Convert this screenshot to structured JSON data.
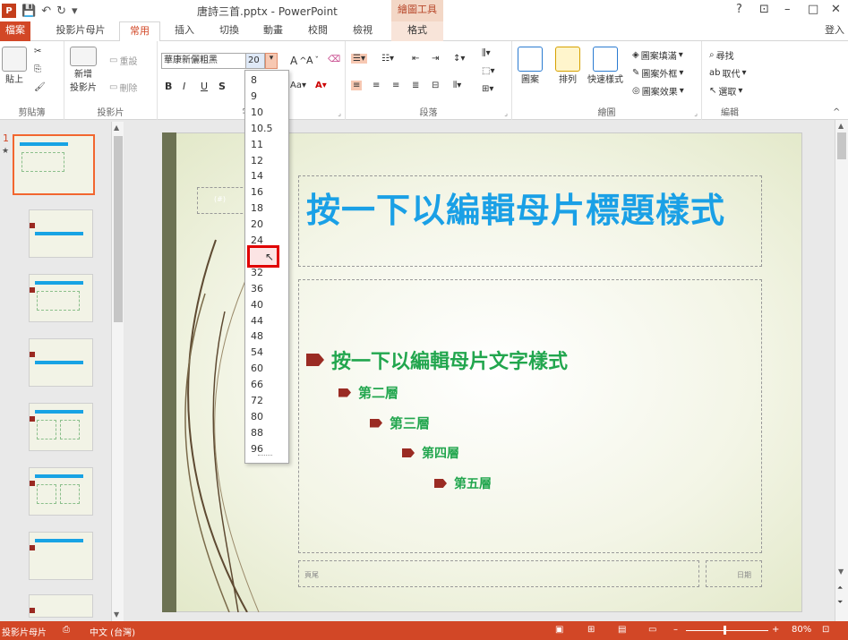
{
  "app": {
    "document_title": "唐詩三首.pptx - PowerPoint",
    "context_tab_group": "繪圖工具",
    "window_controls": [
      "?",
      "⊡",
      "–",
      "□",
      "✕"
    ],
    "signin": "登入"
  },
  "tabs": [
    "檔案",
    "投影片母片",
    "常用",
    "插入",
    "切換",
    "動畫",
    "校閱",
    "檢視",
    "格式"
  ],
  "ribbon": {
    "clipboard": {
      "paste": "貼上",
      "label": "剪貼簿"
    },
    "slides": {
      "new_slide": "新增\n投影片",
      "reset": "重設",
      "delete": "刪除",
      "label": "投影片"
    },
    "font": {
      "font_name": "華康新儷粗黑",
      "font_size": "20",
      "label": "字型",
      "bold": "B",
      "italic": "I",
      "underline": "U",
      "shadow": "S"
    },
    "paragraph": {
      "label": "段落"
    },
    "drawing": {
      "shapes": "圖案",
      "arrange": "排列",
      "quick_styles": "快速樣式",
      "fill": "圖案填滿",
      "outline": "圖案外框",
      "effects": "圖案效果",
      "label": "繪圖"
    },
    "editing": {
      "find": "尋找",
      "replace": "取代",
      "select": "選取",
      "label": "編輯"
    }
  },
  "font_size_list": [
    "8",
    "9",
    "10",
    "10.5",
    "11",
    "12",
    "14",
    "16",
    "18",
    "20",
    "24",
    "28",
    "32",
    "36",
    "40",
    "44",
    "48",
    "54",
    "60",
    "66",
    "72",
    "80",
    "88",
    "96"
  ],
  "font_size_highlighted": "28",
  "slide": {
    "title": "按一下以編輯母片標題樣式",
    "level1": "按一下以編輯母片文字樣式",
    "level2": "第二層",
    "level3": "第三層",
    "level4": "第四層",
    "level5": "第五層",
    "date_placeholder": "(#)",
    "footer_placeholder": "頁尾",
    "number_placeholder": "日期"
  },
  "thumbnails": {
    "first_number": "1",
    "first_mark": "★",
    "first_title": "按一下以編輯母片標題樣式"
  },
  "statusbar": {
    "view": "投影片母片",
    "language": "中文 (台灣)",
    "zoom": "80%"
  }
}
